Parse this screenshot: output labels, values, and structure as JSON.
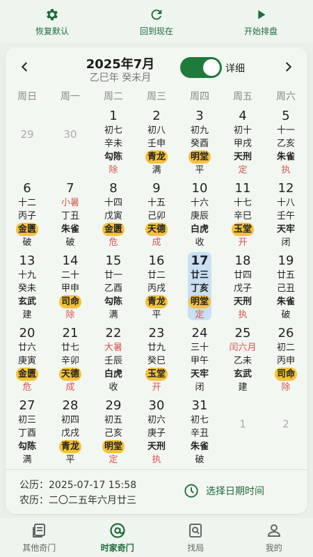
{
  "toolbar": {
    "restore_label": "恢复默认",
    "now_label": "回到现在",
    "start_label": "开始排盘"
  },
  "calendar": {
    "title": "2025年7月",
    "subtitle": "乙巳年 癸未月",
    "detail_label": "详细",
    "detail_on": true,
    "weekdays": [
      "周日",
      "周一",
      "周二",
      "周三",
      "周四",
      "周五",
      "周六"
    ],
    "days": [
      {
        "d": "29",
        "other": true
      },
      {
        "d": "30",
        "other": true
      },
      {
        "d": "1",
        "l": "初七",
        "g": "辛未",
        "s": "勾陈",
        "sh": false,
        "o": "除",
        "or": true
      },
      {
        "d": "2",
        "l": "初八",
        "g": "壬申",
        "s": "青龙",
        "sh": true,
        "o": "满",
        "or": false
      },
      {
        "d": "3",
        "l": "初九",
        "g": "癸酉",
        "s": "明堂",
        "sh": true,
        "o": "平",
        "or": false
      },
      {
        "d": "4",
        "l": "初十",
        "g": "甲戌",
        "s": "天刑",
        "sh": false,
        "o": "定",
        "or": true
      },
      {
        "d": "5",
        "l": "十一",
        "g": "乙亥",
        "s": "朱雀",
        "sh": false,
        "o": "执",
        "or": true
      },
      {
        "d": "6",
        "l": "十二",
        "g": "丙子",
        "s": "金匮",
        "sh": true,
        "o": "破",
        "or": false
      },
      {
        "d": "7",
        "l": "小暑",
        "lr": true,
        "g": "丁丑",
        "s": "朱雀",
        "sh": false,
        "o": "破",
        "or": false
      },
      {
        "d": "8",
        "l": "十四",
        "g": "戊寅",
        "s": "金匮",
        "sh": true,
        "o": "危",
        "or": true
      },
      {
        "d": "9",
        "l": "十五",
        "g": "己卯",
        "s": "天德",
        "sh": true,
        "o": "成",
        "or": true
      },
      {
        "d": "10",
        "l": "十六",
        "g": "庚辰",
        "s": "白虎",
        "sh": false,
        "o": "收",
        "or": false
      },
      {
        "d": "11",
        "l": "十七",
        "g": "辛巳",
        "s": "玉堂",
        "sh": true,
        "o": "开",
        "or": true
      },
      {
        "d": "12",
        "l": "十八",
        "g": "壬午",
        "s": "天牢",
        "sh": false,
        "o": "闭",
        "or": false
      },
      {
        "d": "13",
        "l": "十九",
        "g": "癸未",
        "s": "玄武",
        "sh": false,
        "o": "建",
        "or": false
      },
      {
        "d": "14",
        "l": "二十",
        "g": "甲申",
        "s": "司命",
        "sh": true,
        "o": "除",
        "or": true
      },
      {
        "d": "15",
        "l": "廿一",
        "g": "乙酉",
        "s": "勾陈",
        "sh": false,
        "o": "满",
        "or": false
      },
      {
        "d": "16",
        "l": "廿二",
        "g": "丙戌",
        "s": "青龙",
        "sh": true,
        "o": "平",
        "or": false
      },
      {
        "d": "17",
        "l": "廿三",
        "g": "丁亥",
        "s": "明堂",
        "sh": true,
        "o": "定",
        "or": true,
        "today": true
      },
      {
        "d": "18",
        "l": "廿四",
        "g": "戊子",
        "s": "天刑",
        "sh": false,
        "o": "执",
        "or": true
      },
      {
        "d": "19",
        "l": "廿五",
        "g": "己丑",
        "s": "朱雀",
        "sh": false,
        "o": "破",
        "or": false
      },
      {
        "d": "20",
        "l": "廿六",
        "g": "庚寅",
        "s": "金匮",
        "sh": true,
        "o": "危",
        "or": true
      },
      {
        "d": "21",
        "l": "廿七",
        "g": "辛卯",
        "s": "天德",
        "sh": true,
        "o": "成",
        "or": true
      },
      {
        "d": "22",
        "l": "大暑",
        "lr": true,
        "g": "壬辰",
        "s": "白虎",
        "sh": false,
        "o": "收",
        "or": false
      },
      {
        "d": "23",
        "l": "廿九",
        "g": "癸巳",
        "s": "玉堂",
        "sh": true,
        "o": "开",
        "or": true
      },
      {
        "d": "24",
        "l": "三十",
        "g": "甲午",
        "s": "天牢",
        "sh": false,
        "o": "闭",
        "or": false
      },
      {
        "d": "25",
        "l": "闰六月",
        "lr": true,
        "g": "乙未",
        "s": "玄武",
        "sh": false,
        "o": "建",
        "or": false
      },
      {
        "d": "26",
        "l": "初二",
        "g": "丙申",
        "s": "司命",
        "sh": true,
        "o": "除",
        "or": true
      },
      {
        "d": "27",
        "l": "初三",
        "g": "丁酉",
        "s": "勾陈",
        "sh": false,
        "o": "满",
        "or": false
      },
      {
        "d": "28",
        "l": "初四",
        "g": "戊戌",
        "s": "青龙",
        "sh": true,
        "o": "平",
        "or": false
      },
      {
        "d": "29",
        "l": "初五",
        "g": "己亥",
        "s": "明堂",
        "sh": true,
        "o": "定",
        "or": true
      },
      {
        "d": "30",
        "l": "初六",
        "g": "庚子",
        "s": "天刑",
        "sh": false,
        "o": "执",
        "or": true
      },
      {
        "d": "31",
        "l": "初七",
        "g": "辛丑",
        "s": "朱雀",
        "sh": false,
        "o": "破",
        "or": false
      },
      {
        "d": "1",
        "other": true
      },
      {
        "d": "2",
        "other": true
      }
    ]
  },
  "info": {
    "solar": "公历：2025-07-17 15:58",
    "lunar": "农历：二〇二五年六月廿三",
    "pick_label": "选择日期时间"
  },
  "nav": {
    "items": [
      {
        "label": "其他奇门",
        "icon": "book-icon"
      },
      {
        "label": "时家奇门",
        "icon": "at-icon"
      },
      {
        "label": "找局",
        "icon": "search-doc-icon"
      },
      {
        "label": "我的",
        "icon": "person-icon"
      }
    ],
    "active_index": 1
  },
  "colors": {
    "accent": "#1e6b3a",
    "highlight": "#f7c23b",
    "today": "#c9dff4",
    "red": "#d9534f"
  }
}
